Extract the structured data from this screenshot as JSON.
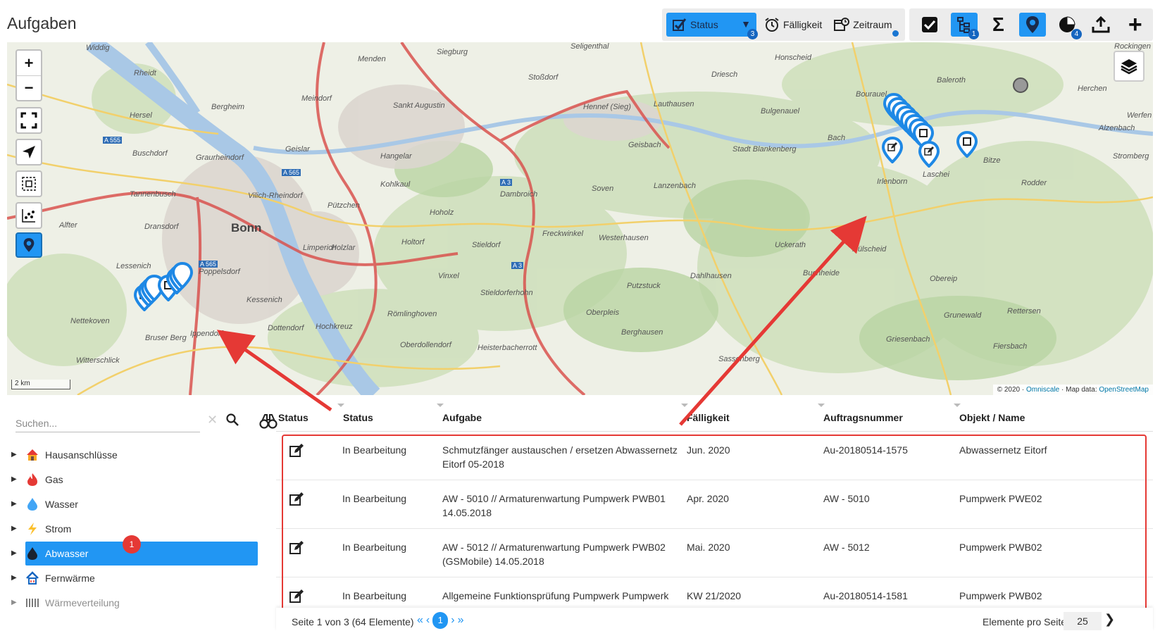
{
  "page": {
    "title": "Aufgaben"
  },
  "toolbar": {
    "status_label": "Status",
    "status_badge": "3",
    "faelligkeit_label": "Fälligkeit",
    "zeitraum_label": "Zeitraum",
    "tree_badge": "1",
    "pie_badge": "4",
    "accent": "#2196f3"
  },
  "map": {
    "city_label": "Bonn",
    "labels": [
      "Widdig",
      "Rheidt",
      "Hersel",
      "Bergheim",
      "Meindorf",
      "Menden",
      "Siegburg",
      "Sankt Augustin",
      "Stoßdorf",
      "Seligenthal",
      "Hennef (Sieg)",
      "Lauthausen",
      "Driesch",
      "Honscheid",
      "Baleroth",
      "Herchen",
      "Bourauel",
      "Alzenbach",
      "Stromberg",
      "Bitze",
      "Laschei",
      "Irlenborn",
      "Rodder",
      "Bulgenauel",
      "Bach",
      "Stadt Blankenberg",
      "Geisbach",
      "Lanzenbach",
      "Soven",
      "Dambroich",
      "Kohlkaul",
      "Hangelar",
      "Geislar",
      "Graurheindorf",
      "Buschdorf",
      "Tannenbusch",
      "Vilich-Rheindorf",
      "Pützchen",
      "Holzlar",
      "Hoholz",
      "Dransdorf",
      "Alfter",
      "Limperich",
      "Holtorf",
      "Stieldorf",
      "Freckwinkel",
      "Westerhausen",
      "Lessenich",
      "Poppelsdorf",
      "Kessenich",
      "Vinxel",
      "Stieldorferhohn",
      "Oberpleis",
      "Putzstuck",
      "Dahlhausen",
      "Uckerath",
      "Buchheide",
      "Hülscheid",
      "Obereip",
      "Nettekoven",
      "Bruser Berg",
      "Ippendorf",
      "Dottendorf",
      "Hochkreuz",
      "Römlinghoven",
      "Oberdollendorf",
      "Heisterbacherrott",
      "Berghausen",
      "Griesenbach",
      "Rettersen",
      "Grunewald",
      "Fiersbach",
      "Sassenberg",
      "Witterschlick",
      "Rockingen",
      "Werfen"
    ],
    "road_labels": [
      "A 555",
      "A 565",
      "A 565",
      "A 3",
      "A 3"
    ],
    "scale_label": "2 km",
    "attribution_prefix": "© 2020 ·",
    "attribution_omniscale": "Omniscale",
    "attribution_middle": "· Map data:",
    "attribution_osm": "OpenStreetMap"
  },
  "sidebar": {
    "search_placeholder": "Suchen...",
    "items": [
      {
        "label": "Hausanschlüsse",
        "icon": "house-icon"
      },
      {
        "label": "Gas",
        "icon": "flame-icon"
      },
      {
        "label": "Wasser",
        "icon": "water-drop-icon"
      },
      {
        "label": "Strom",
        "icon": "lightning-icon"
      },
      {
        "label": "Abwasser",
        "icon": "drop-dark-icon",
        "selected": true,
        "badge": "1"
      },
      {
        "label": "Fernwärme",
        "icon": "house-heat-icon"
      },
      {
        "label": "Wärmeverteilung",
        "icon": "radiator-icon"
      }
    ]
  },
  "table": {
    "headers": [
      "Status",
      "Status",
      "Aufgabe",
      "Fälligkeit",
      "Auftragsnummer",
      "Objekt / Name"
    ],
    "rows": [
      {
        "status": "In Bearbeitung",
        "aufgabe_1": "Schmutzfänger austauschen / ersetzen Abwassernetz",
        "aufgabe_2": "Eitorf 05-2018",
        "faelligkeit": "Jun. 2020",
        "auftrag": "Au-20180514-1575",
        "objekt": "Abwassernetz Eitorf"
      },
      {
        "status": "In Bearbeitung",
        "aufgabe_1": "AW - 5010 // Armaturenwartung Pumpwerk PWB01",
        "aufgabe_2": "14.05.2018",
        "faelligkeit": "Apr. 2020",
        "auftrag": "AW - 5010",
        "objekt": "Pumpwerk PWE02"
      },
      {
        "status": "In Bearbeitung",
        "aufgabe_1": "AW - 5012 // Armaturenwartung Pumpwerk PWB02",
        "aufgabe_2": "(GSMobile) 14.05.2018",
        "faelligkeit": "Mai. 2020",
        "auftrag": "AW - 5012",
        "objekt": "Pumpwerk PWB02"
      },
      {
        "status": "In Bearbeitung",
        "aufgabe_1": "Allgemeine Funktionsprüfung Pumpwerk Pumpwerk",
        "aufgabe_2": "",
        "faelligkeit": "KW 21/2020",
        "auftrag": "Au-20180514-1581",
        "objekt": "Pumpwerk PWB02"
      }
    ]
  },
  "footer": {
    "page_text": "Seite 1 von 3 (64 Elemente)",
    "current_page": "1",
    "per_page_label": "Elemente pro Seite",
    "per_page_value": "25"
  }
}
